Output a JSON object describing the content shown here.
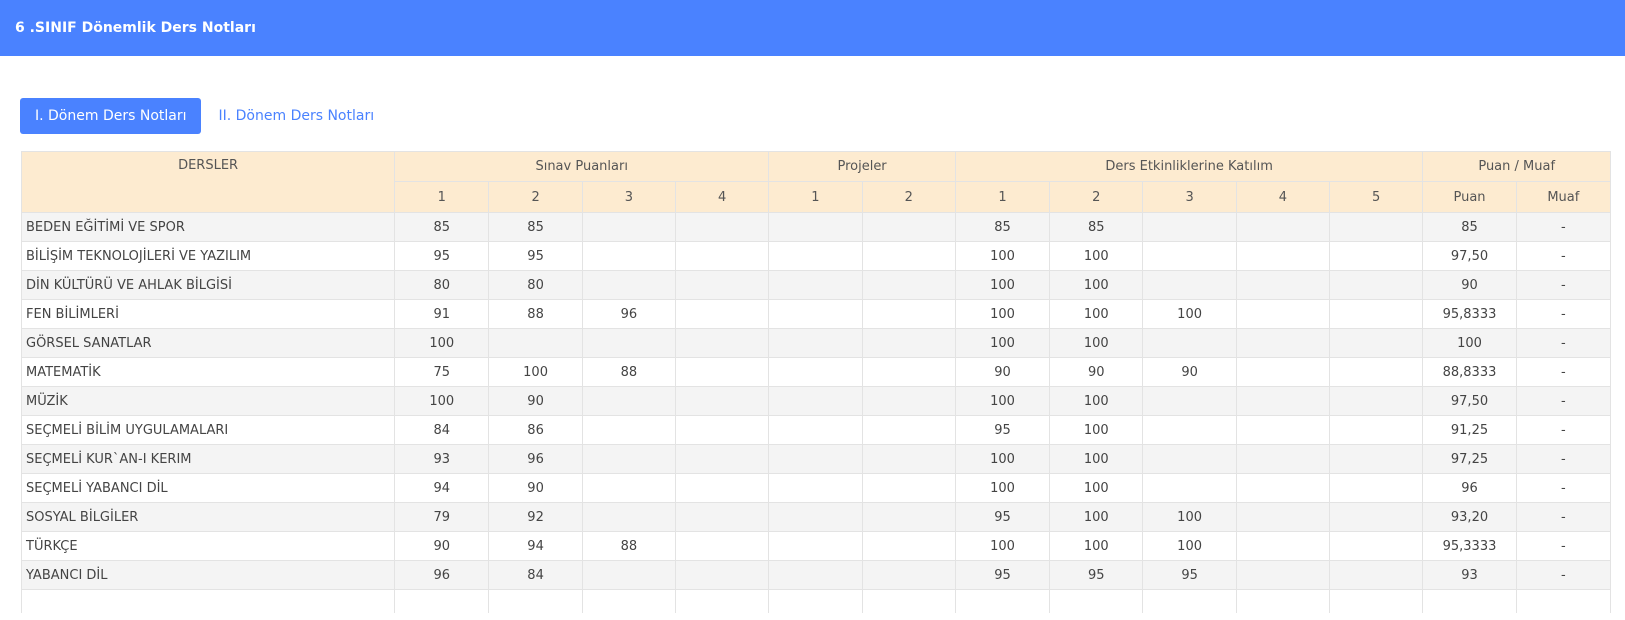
{
  "header": {
    "title": "6 .SINIF Dönemlik Ders Notları"
  },
  "tabs": [
    {
      "label": "I. Dönem Ders Notları",
      "active": true
    },
    {
      "label": "II. Dönem Ders Notları",
      "active": false
    }
  ],
  "table": {
    "groups": {
      "dersler": "DERSLER",
      "sinav": "Sınav Puanları",
      "projeler": "Projeler",
      "etkinlik": "Ders Etkinliklerine Katılım",
      "puan_muaf": "Puan / Muaf"
    },
    "sub_headers": [
      "1",
      "2",
      "3",
      "4",
      "1",
      "2",
      "1",
      "2",
      "3",
      "4",
      "5",
      "Puan",
      "Muaf"
    ],
    "rows": [
      [
        "BEDEN EĞİTİMİ VE SPOR",
        "85",
        "85",
        "",
        "",
        "",
        "",
        "85",
        "85",
        "",
        "",
        "",
        "85",
        "-"
      ],
      [
        "BİLİŞİM TEKNOLOJİLERİ VE YAZILIM",
        "95",
        "95",
        "",
        "",
        "",
        "",
        "100",
        "100",
        "",
        "",
        "",
        "97,50",
        "-"
      ],
      [
        "DİN KÜLTÜRÜ VE AHLAK BİLGİSİ",
        "80",
        "80",
        "",
        "",
        "",
        "",
        "100",
        "100",
        "",
        "",
        "",
        "90",
        "-"
      ],
      [
        "FEN BİLİMLERİ",
        "91",
        "88",
        "96",
        "",
        "",
        "",
        "100",
        "100",
        "100",
        "",
        "",
        "95,8333",
        "-"
      ],
      [
        "GÖRSEL SANATLAR",
        "100",
        "",
        "",
        "",
        "",
        "",
        "100",
        "100",
        "",
        "",
        "",
        "100",
        "-"
      ],
      [
        "MATEMATİK",
        "75",
        "100",
        "88",
        "",
        "",
        "",
        "90",
        "90",
        "90",
        "",
        "",
        "88,8333",
        "-"
      ],
      [
        "MÜZİK",
        "100",
        "90",
        "",
        "",
        "",
        "",
        "100",
        "100",
        "",
        "",
        "",
        "97,50",
        "-"
      ],
      [
        "SEÇMELİ BİLİM UYGULAMALARI",
        "84",
        "86",
        "",
        "",
        "",
        "",
        "95",
        "100",
        "",
        "",
        "",
        "91,25",
        "-"
      ],
      [
        "SEÇMELİ KUR`AN-I KERIM",
        "93",
        "96",
        "",
        "",
        "",
        "",
        "100",
        "100",
        "",
        "",
        "",
        "97,25",
        "-"
      ],
      [
        "SEÇMELİ YABANCI DİL",
        "94",
        "90",
        "",
        "",
        "",
        "",
        "100",
        "100",
        "",
        "",
        "",
        "96",
        "-"
      ],
      [
        "SOSYAL BİLGİLER",
        "79",
        "92",
        "",
        "",
        "",
        "",
        "95",
        "100",
        "100",
        "",
        "",
        "93,20",
        "-"
      ],
      [
        "TÜRKÇE",
        "90",
        "94",
        "88",
        "",
        "",
        "",
        "100",
        "100",
        "100",
        "",
        "",
        "95,3333",
        "-"
      ],
      [
        "YABANCI DİL",
        "96",
        "84",
        "",
        "",
        "",
        "",
        "95",
        "95",
        "95",
        "",
        "",
        "93",
        "-"
      ],
      [
        "",
        "",
        "",
        "",
        "",
        "",
        "",
        "",
        "",
        "",
        "",
        "",
        "",
        ""
      ]
    ]
  }
}
